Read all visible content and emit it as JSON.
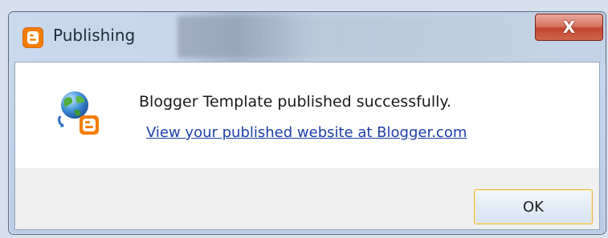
{
  "window": {
    "title": "Publishing",
    "close_label": "X"
  },
  "message": {
    "text": "Blogger Template published successfully.",
    "link": "View your published website at Blogger.com"
  },
  "buttons": {
    "ok_label": "OK"
  },
  "icons": {
    "app": "blogger-icon",
    "message": "globe-blogger-icon"
  },
  "colors": {
    "blogger_orange": "#f57d00",
    "link_blue": "#1d3ea8",
    "ok_border": "#e6b84a"
  }
}
